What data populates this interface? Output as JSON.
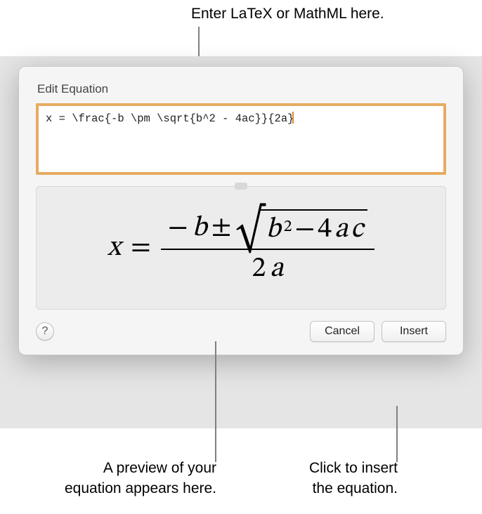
{
  "callouts": {
    "top": "Enter LaTeX or MathML here.",
    "bottom_left": "A preview of your\nequation appears here.",
    "bottom_right": "Click to insert\nthe equation."
  },
  "dialog": {
    "title": "Edit Equation",
    "input_value": "x = \\frac{-b \\pm \\sqrt{b^2 - 4ac}}{2a}",
    "buttons": {
      "help_label": "?",
      "cancel_label": "Cancel",
      "insert_label": "Insert"
    }
  },
  "preview": {
    "lhs_var": "x",
    "equals": "=",
    "minus": "−",
    "pm": "±",
    "b": "b",
    "sq": "2",
    "four": "4",
    "a": "a",
    "c": "c",
    "den_two": "2",
    "den_a": "a"
  }
}
